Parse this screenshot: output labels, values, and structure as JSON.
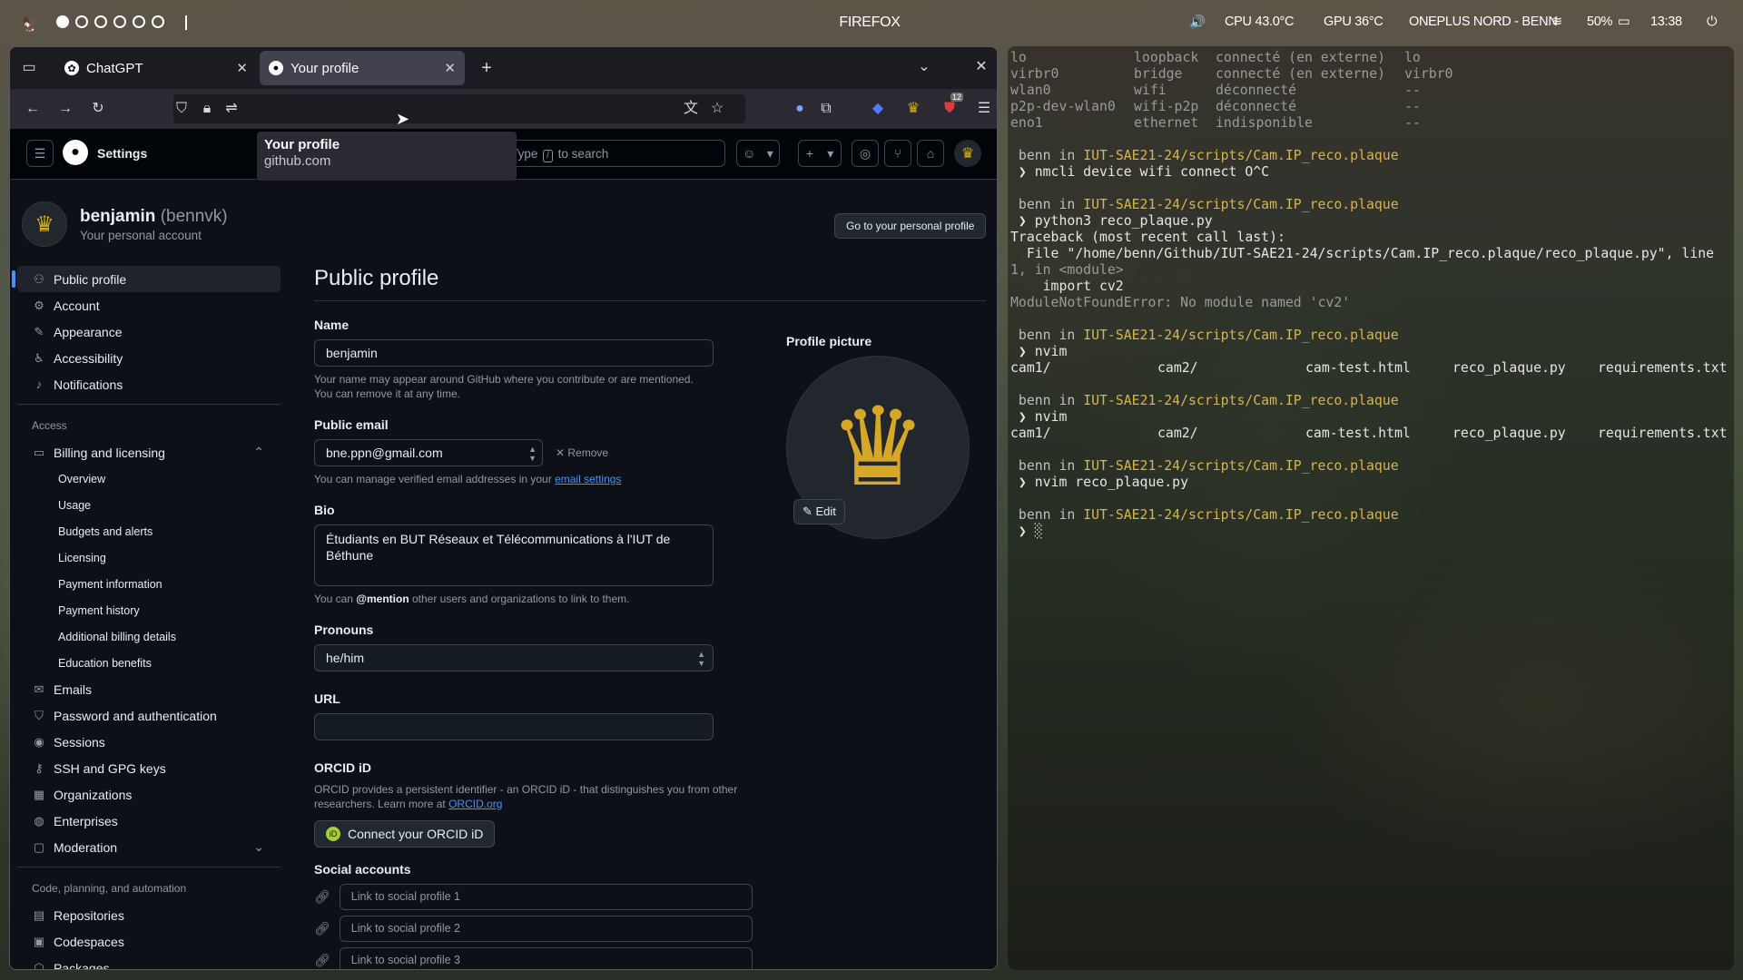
{
  "topbar": {
    "title": "FIREFOX",
    "cpu": "CPU 43.0°C",
    "gpu": "GPU 36°C",
    "network": "ONEPLUS NORD - BENN",
    "battery": "50%",
    "time": "13:38"
  },
  "browser": {
    "tabs": [
      {
        "label": "ChatGPT"
      },
      {
        "label": "Your profile"
      }
    ],
    "tooltip": {
      "title": "Your profile",
      "domain": "github.com"
    },
    "notif_badge": "12"
  },
  "github": {
    "header_title": "Settings",
    "search_pre": "Type",
    "search_key": "/",
    "search_post": "to search",
    "user": {
      "name": "benjamin",
      "handle": "(bennvk)",
      "subtitle": "Your personal account"
    },
    "go_profile_button": "Go to your personal profile",
    "sidebar": {
      "items_top": [
        {
          "label": "Public profile",
          "icon": "person-icon"
        },
        {
          "label": "Account",
          "icon": "gear-icon"
        },
        {
          "label": "Appearance",
          "icon": "paintbrush-icon"
        },
        {
          "label": "Accessibility",
          "icon": "accessibility-icon"
        },
        {
          "label": "Notifications",
          "icon": "bell-icon"
        }
      ],
      "access_heading": "Access",
      "billing": "Billing and licensing",
      "billing_sub": [
        "Overview",
        "Usage",
        "Budgets and alerts",
        "Licensing",
        "Payment information",
        "Payment history",
        "Additional billing details",
        "Education benefits"
      ],
      "items_mid": [
        {
          "label": "Emails",
          "icon": "mail-icon"
        },
        {
          "label": "Password and authentication",
          "icon": "shield-icon"
        },
        {
          "label": "Sessions",
          "icon": "broadcast-icon"
        },
        {
          "label": "SSH and GPG keys",
          "icon": "key-icon"
        },
        {
          "label": "Organizations",
          "icon": "organization-icon"
        },
        {
          "label": "Enterprises",
          "icon": "globe-icon"
        },
        {
          "label": "Moderation",
          "icon": "report-icon"
        }
      ],
      "code_heading": "Code, planning, and automation",
      "items_code": [
        {
          "label": "Repositories",
          "icon": "repo-icon"
        },
        {
          "label": "Codespaces",
          "icon": "codespaces-icon"
        },
        {
          "label": "Packages",
          "icon": "package-icon"
        }
      ]
    },
    "form": {
      "heading": "Public profile",
      "name_label": "Name",
      "name_value": "benjamin",
      "name_note": "Your name may appear around GitHub where you contribute or are mentioned. You can remove it at any time.",
      "email_label": "Public email",
      "email_value": "bne.ppn@gmail.com",
      "remove_label": "Remove",
      "email_note_pre": "You can manage verified email addresses in your",
      "email_note_link": "email settings",
      "bio_label": "Bio",
      "bio_value": "Étudiants en BUT Réseaux et Télécommunications à l'IUT de Béthune",
      "bio_note_pre": "You can",
      "bio_note_bold": "@mention",
      "bio_note_post": "other users and organizations to link to them.",
      "pronouns_label": "Pronouns",
      "pronouns_value": "he/him",
      "url_label": "URL",
      "url_value": "",
      "orcid_label": "ORCID iD",
      "orcid_note": "ORCID provides a persistent identifier - an ORCID iD - that distinguishes you from other researchers. Learn more at",
      "orcid_link": "ORCID.org",
      "orcid_button": "Connect your ORCID iD",
      "social_label": "Social accounts",
      "social_placeholders": [
        "Link to social profile 1",
        "Link to social profile 2",
        "Link to social profile 3"
      ],
      "picture_label": "Profile picture",
      "edit_button": "Edit"
    }
  },
  "terminal": {
    "net_rows": [
      [
        "lo",
        "loopback",
        "connecté (en externe)",
        "lo"
      ],
      [
        "virbr0",
        "bridge",
        "connecté (en externe)",
        "virbr0"
      ],
      [
        "wlan0",
        "wifi",
        "déconnecté",
        "--"
      ],
      [
        "p2p-dev-wlan0",
        "wifi-p2p",
        "déconnecté",
        "--"
      ],
      [
        "eno1",
        "ethernet",
        "indisponible",
        "--"
      ]
    ],
    "user": "benn",
    "in": "in",
    "path": "IUT-SAE21-24/scripts/Cam.IP_reco.plaque",
    "cmd1": "nmcli device wifi connect O^C",
    "cmd2": "python3 reco_plaque.py",
    "traceback": "Traceback (most recent call last):",
    "file_line": "  File \"/home/benn/Github/IUT-SAE21-24/scripts/Cam.IP_reco.plaque/reco_plaque.py\", line",
    "file_line2": "1, in <module>",
    "import_line": "    import cv2",
    "error_line": "ModuleNotFoundError: No module named 'cv2'",
    "cmd3": "nvim",
    "files": [
      "cam1/",
      "cam2/",
      "cam-test.html",
      "reco_plaque.py",
      "requirements.txt"
    ],
    "cmd4": "nvim",
    "cmd5": "nvim reco_plaque.py",
    "prompt": "❯"
  },
  "colors": {
    "accent": "#4493f8",
    "term_yellow": "#d7b54a",
    "gh_bg": "#0d1117"
  }
}
